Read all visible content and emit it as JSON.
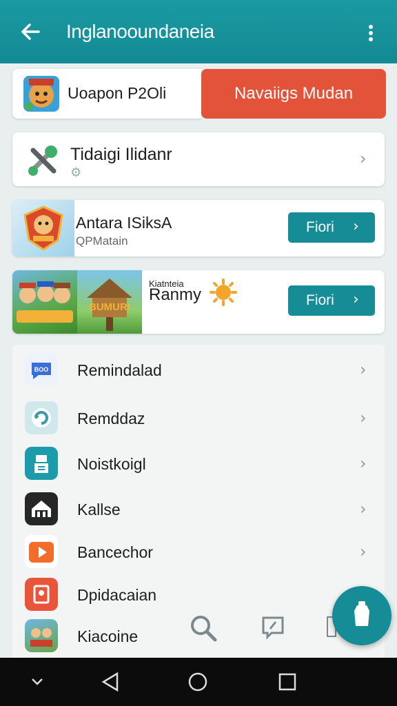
{
  "appbar": {
    "title": "Inglanooundaneia",
    "back_icon": "arrow-left-icon",
    "menu_icon": "more-vert-icon"
  },
  "promo": {
    "name": "Uoapon P2Oli",
    "cta": "Navaiigs Mudan"
  },
  "tool_card": {
    "name": "Tidaigi Ilidanr",
    "icon": "tools-icon"
  },
  "game_card_1": {
    "name": "Antara ISiksA",
    "subtitle": "QPMatain",
    "button": "Fiori"
  },
  "game_card_2": {
    "small_label": "Kiatnteia",
    "name": "Ranmy",
    "art_text": "BUMURI",
    "button": "Fiori"
  },
  "list": [
    {
      "label": "Remindalad",
      "icon": "chat-icon",
      "color": "#3a6ed8"
    },
    {
      "label": "Remddaz",
      "icon": "refresh-icon",
      "color": "#7ec0c8"
    },
    {
      "label": "Noistkoigl",
      "icon": "robot-icon",
      "color": "#1c9bab"
    },
    {
      "label": "Kallse",
      "icon": "home-icon",
      "color": "#262626"
    },
    {
      "label": "Bancechor",
      "icon": "play-icon",
      "color": "#f26c2a"
    },
    {
      "label": "Dpidacaian",
      "icon": "badge-icon",
      "color": "#e8553a"
    },
    {
      "label": "Kiacoine",
      "icon": "game-thumbnail-icon",
      "color": "#6aa34a"
    }
  ],
  "colors": {
    "appbar": "#168d96",
    "cta": "#e2533a",
    "accent": "#168d96"
  }
}
